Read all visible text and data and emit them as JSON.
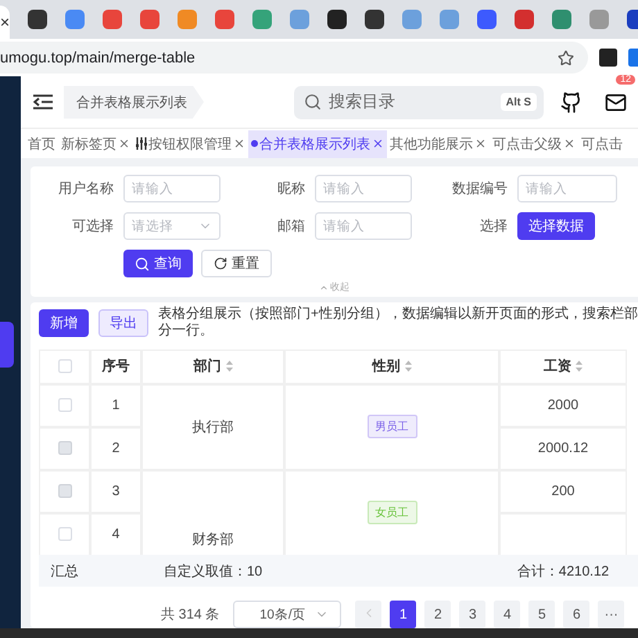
{
  "browser": {
    "close": "×",
    "address": "umogu.top/main/merge-table"
  },
  "header": {
    "breadcrumb": "合并表格展示列表",
    "search": {
      "placeholder": "搜索目录",
      "shortcut": "Alt S"
    },
    "mail_badge": "12"
  },
  "tabs": [
    {
      "label": "首页",
      "closable": false,
      "icon": false,
      "selected": false
    },
    {
      "label": "新标签页",
      "closable": true,
      "icon": false,
      "selected": false
    },
    {
      "label": "按钮权限管理",
      "closable": true,
      "icon": true,
      "selected": false
    },
    {
      "label": "合并表格展示列表",
      "closable": true,
      "icon": false,
      "selected": true
    },
    {
      "label": "其他功能展示",
      "closable": true,
      "icon": false,
      "selected": false
    },
    {
      "label": "可点击父级",
      "closable": true,
      "icon": false,
      "selected": false
    },
    {
      "label": "可点击",
      "closable": false,
      "icon": false,
      "selected": false
    }
  ],
  "filter": {
    "fields": [
      {
        "label": "用户名称",
        "kind": "input",
        "placeholder": "请输入"
      },
      {
        "label": "昵称",
        "kind": "input",
        "placeholder": "请输入"
      },
      {
        "label": "数据编号",
        "kind": "input",
        "placeholder": "请输入"
      },
      {
        "label": "可选择",
        "kind": "select",
        "placeholder": "请选择"
      },
      {
        "label": "邮箱",
        "kind": "input",
        "placeholder": "请输入"
      },
      {
        "label": "选择",
        "kind": "button",
        "button": "选择数据"
      }
    ],
    "search_button": "查询",
    "reset_button": "重置",
    "collapse": "收起"
  },
  "toolbar": {
    "add": "新增",
    "export": "导出",
    "description": "表格分组展示（按照部门+性别分组），数据编辑以新开页面的形式，搜索栏部分一行。"
  },
  "table": {
    "all_checked": false,
    "columns": [
      "序号",
      "部门",
      "性别",
      "工资"
    ],
    "groups": [
      {
        "department": "执行部",
        "gender": "男员工",
        "color": "#7b61e8",
        "rows": [
          {
            "no": "1",
            "salary": "2000",
            "disabled": false
          },
          {
            "no": "2",
            "salary": "2000.12",
            "disabled": true
          }
        ]
      },
      {
        "department": "财务部",
        "gender": "女员工",
        "color": "#67c23a",
        "rows": [
          {
            "no": "3",
            "salary": "200",
            "disabled": true
          },
          {
            "no": "4",
            "salary": "",
            "disabled": false
          }
        ]
      }
    ]
  },
  "summary": {
    "label": "汇总",
    "custom": "自定义取值：10",
    "total": "合计：4210.12"
  },
  "pagination": {
    "total": "共 314 条",
    "page_size": "10条/页",
    "pages": [
      {
        "label": "1",
        "selected": true
      },
      {
        "label": "2",
        "selected": false
      },
      {
        "label": "3",
        "selected": false
      },
      {
        "label": "4",
        "selected": false
      },
      {
        "label": "5",
        "selected": false
      },
      {
        "label": "6",
        "selected": false
      }
    ],
    "more": "···"
  }
}
